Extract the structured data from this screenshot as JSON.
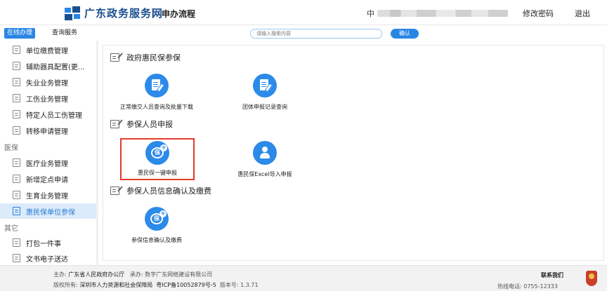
{
  "header": {
    "site_title": "广东政务服务网",
    "page_flow": "申办流程",
    "user_prefix": "中",
    "change_password": "修改密码",
    "logout": "退出"
  },
  "nav": {
    "online_tab": "在线办理",
    "query_tab": "查询服务",
    "search_placeholder": "请输入搜索内容",
    "search_button": "确认"
  },
  "sidebar": {
    "items": [
      {
        "label": "单位缴费管理"
      },
      {
        "label": "辅助器具配置(更..."
      },
      {
        "label": "失业业务管理"
      },
      {
        "label": "工伤业务管理"
      },
      {
        "label": "特定人员工伤管理"
      },
      {
        "label": "转移申请管理"
      },
      {
        "label": "医疗业务管理"
      },
      {
        "label": "新增定点申请"
      },
      {
        "label": "生育业务管理"
      },
      {
        "label": "惠民保单位参保"
      },
      {
        "label": "打包一件事"
      },
      {
        "label": "文书电子送达"
      }
    ],
    "headings": [
      "医保",
      "其它"
    ],
    "active_item": "惠民保单位参保"
  },
  "main": {
    "sections": [
      {
        "title": "政府惠民保参保",
        "services": [
          {
            "label": "正常缴交人员查询及批量下载",
            "icon": "document-edit-icon"
          },
          {
            "label": "团体申报记录查询",
            "icon": "document-edit-icon"
          }
        ]
      },
      {
        "title": "参保人员申报",
        "services": [
          {
            "label": "惠民保一键申报",
            "icon": "bao-plus-icon",
            "glyph": "保",
            "badge": "+"
          },
          {
            "label": "惠民保Excel导入申报",
            "icon": "person-upload-icon"
          }
        ]
      },
      {
        "title": "参保人员信息确认及缴费",
        "services": [
          {
            "label": "参保信息确认及缴费",
            "icon": "bao-plus-icon",
            "glyph": "保",
            "badge": "+"
          }
        ]
      }
    ]
  },
  "footer": {
    "sponsor_label": "主办:",
    "sponsor": "广东省人民政府办公厅",
    "operator_label": "承办:",
    "operator": "数字广东网络建设有限公司",
    "copyright_label": "版权所有:",
    "copyright": "深圳市人力资源和社会保障局",
    "icp": "粤ICP备10052879号-5",
    "version_label": "版本号:",
    "version": "1.3.71",
    "contact_title": "联系我们",
    "hotline_label": "热线电话:",
    "hotline": "0755-12333"
  },
  "colors": {
    "brand_blue": "#2c8ae8",
    "highlight_red": "#e23b2b",
    "active_bg": "#dcebfa"
  }
}
